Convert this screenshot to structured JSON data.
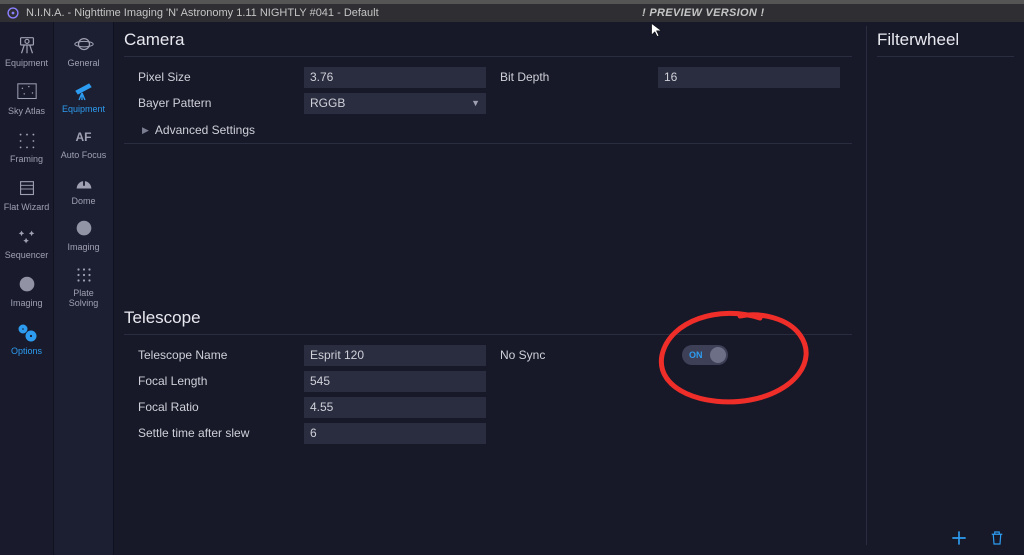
{
  "window": {
    "title": "N.I.N.A. - Nighttime Imaging 'N' Astronomy 1.11 NIGHTLY #041  -  Default",
    "preview_banner": "! PREVIEW VERSION !"
  },
  "primary_nav": [
    {
      "id": "equipment",
      "label": "Equipment",
      "icon": "camera-tripod-icon"
    },
    {
      "id": "skyatlas",
      "label": "Sky Atlas",
      "icon": "stars-icon"
    },
    {
      "id": "framing",
      "label": "Framing",
      "icon": "frame-dots-icon"
    },
    {
      "id": "flatwizard",
      "label": "Flat Wizard",
      "icon": "swatch-icon"
    },
    {
      "id": "sequencer",
      "label": "Sequencer",
      "icon": "wand-stars-icon"
    },
    {
      "id": "imaging",
      "label": "Imaging",
      "icon": "globe-icon"
    },
    {
      "id": "options",
      "label": "Options",
      "icon": "gears-icon",
      "selected": true
    }
  ],
  "secondary_nav": [
    {
      "id": "general",
      "label": "General",
      "icon": "planet-icon"
    },
    {
      "id": "equipment2",
      "label": "Equipment",
      "icon": "telescope-icon",
      "selected": true
    },
    {
      "id": "autofocus",
      "label": "Auto Focus",
      "icon": "af-icon",
      "text_glyph": "AF"
    },
    {
      "id": "dome",
      "label": "Dome",
      "icon": "dome-icon"
    },
    {
      "id": "imaging2",
      "label": "Imaging",
      "icon": "globe-icon"
    },
    {
      "id": "platesolving",
      "label": "Plate Solving",
      "icon": "grid-icon"
    }
  ],
  "camera": {
    "section_title": "Camera",
    "pixel_size": {
      "label": "Pixel Size",
      "value": "3.76"
    },
    "bit_depth": {
      "label": "Bit Depth",
      "value": "16"
    },
    "bayer_pattern": {
      "label": "Bayer Pattern",
      "value": "RGGB"
    },
    "advanced_settings_label": "Advanced Settings"
  },
  "telescope": {
    "section_title": "Telescope",
    "name": {
      "label": "Telescope Name",
      "value": "Esprit 120"
    },
    "focal": {
      "label": "Focal Length",
      "value": "545"
    },
    "ratio": {
      "label": "Focal Ratio",
      "value": "4.55"
    },
    "settle": {
      "label": "Settle time after slew",
      "value": "6"
    },
    "no_sync": {
      "label": "No Sync",
      "toggle_text": "ON",
      "on": true
    }
  },
  "right_panel": {
    "title": "Filterwheel"
  },
  "annotation": {
    "kind": "freehand-circle",
    "color": "#ef2d29",
    "target": "telescope.no_sync toggle"
  }
}
